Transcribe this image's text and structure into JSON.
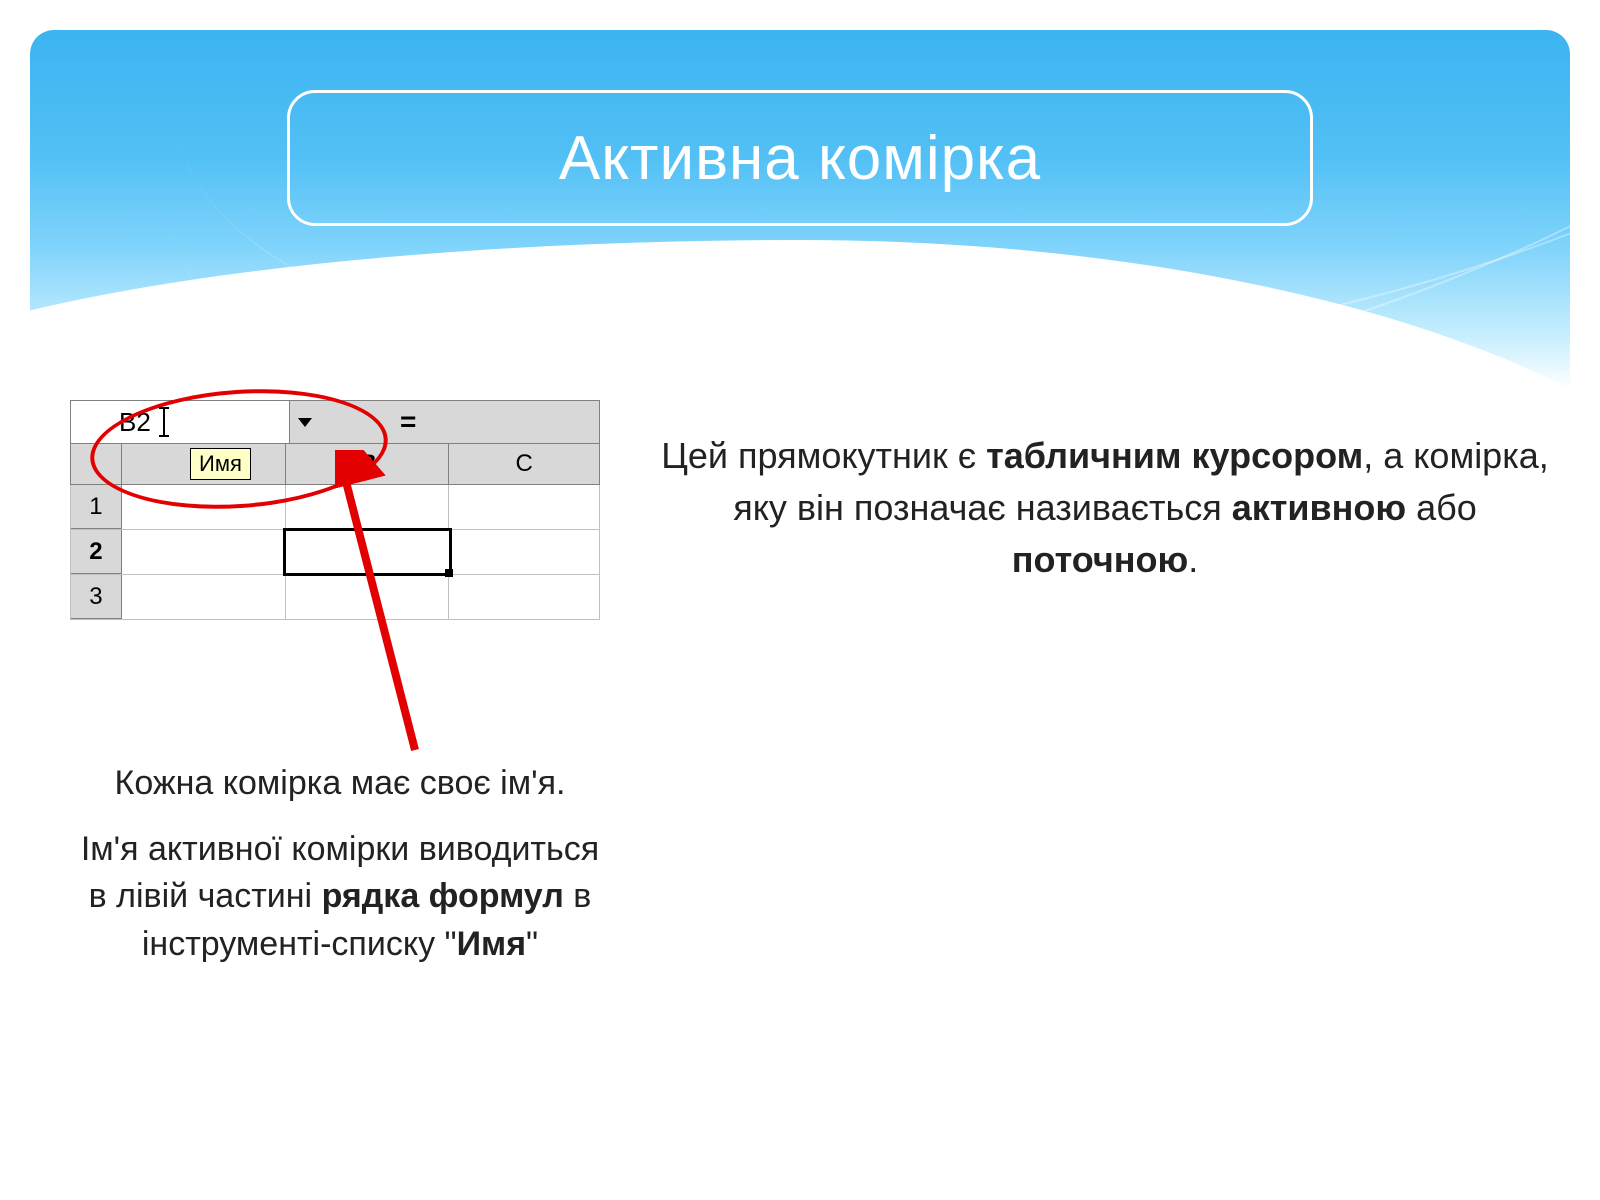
{
  "title": "Активна комірка",
  "excel": {
    "name_box_value": "B2",
    "tooltip": "Имя",
    "formula_eq": "=",
    "col_headers": {
      "a": "",
      "b": "B",
      "c": "C"
    },
    "rows": [
      "1",
      "2",
      "3"
    ]
  },
  "right_paragraph": {
    "t1": "Цей прямокутник є ",
    "b1": "табличним курсором",
    "t2": ", а комірка, яку він позначає називається ",
    "b2": "активною",
    "t3": " або ",
    "b3": "поточною",
    "t4": "."
  },
  "bottom_paragraph": {
    "p1": "Кожна комірка має своє ім'я.",
    "p2_t1": "Ім'я активної комірки виводиться в лівій частині ",
    "p2_b1": "рядка формул",
    "p2_t2": "  в інструменті-списку \"",
    "p2_b2": "Имя",
    "p2_t3": "\""
  }
}
